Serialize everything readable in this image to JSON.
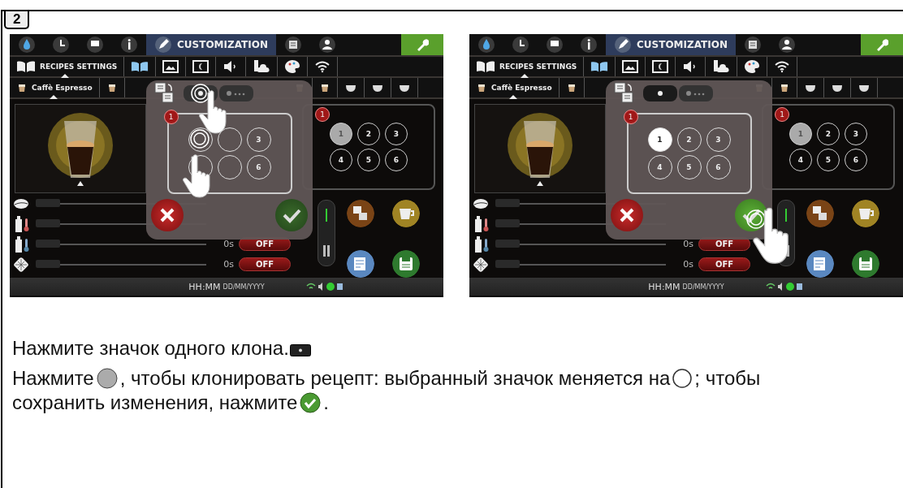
{
  "step": {
    "label": "2"
  },
  "screens": [
    {
      "top_tabs": [
        {
          "selected": false
        },
        {
          "selected": false
        },
        {
          "selected": false
        },
        {
          "selected": false
        },
        {
          "label": "CUSTOMIZATION",
          "selected": true
        },
        {
          "selected": false
        },
        {
          "selected": false
        }
      ],
      "settings_tabs": [
        {
          "label": "RECIPES SETTINGS",
          "selected": true
        },
        {
          "selected": false
        },
        {
          "selected": false
        },
        {
          "selected": false
        },
        {
          "selected": false
        },
        {
          "selected": false
        },
        {
          "selected": false
        },
        {
          "selected": false
        }
      ],
      "recipe_tabs": [
        {
          "label": "Caffè Espresso",
          "selected": true
        },
        {
          "selected": false
        },
        {
          "selected": false
        },
        {
          "selected": false
        },
        {
          "selected": false
        },
        {
          "selected": false
        },
        {
          "selected": false
        }
      ],
      "sliders": [
        {
          "level": 0
        },
        {
          "level": 0
        },
        {
          "level": 0,
          "time": "0s",
          "switch": "OFF",
          "on": false
        },
        {
          "level": 0,
          "time": "0s",
          "switch": "OFF",
          "on": false
        }
      ],
      "preview_panel": {
        "badge": "1",
        "circles": [
          {
            "label": "1",
            "selected": true
          },
          {
            "label": "2",
            "selected": false
          },
          {
            "label": "3",
            "selected": false
          },
          {
            "label": "4",
            "selected": false
          },
          {
            "label": "5",
            "selected": false
          },
          {
            "label": "6",
            "selected": false
          }
        ]
      },
      "popup": {
        "modes": [
          {
            "selected": false,
            "touched": true
          },
          {
            "selected": false,
            "touched": false
          }
        ],
        "badge": "1",
        "circles": [
          {
            "selected": false,
            "touched": true
          },
          {
            "selected": false,
            "touched": false
          },
          {
            "label": "3",
            "selected": false,
            "touched": false
          },
          {
            "selected": false,
            "touched": false
          },
          {
            "selected": false,
            "touched": false
          },
          {
            "label": "6",
            "selected": false,
            "touched": false
          }
        ],
        "cancel": {
          "touched": false
        },
        "confirm": {
          "touched": false
        }
      },
      "status": {
        "time": "HH:MM",
        "date": "DD/MM/YYYY"
      }
    },
    {
      "top_tabs": [
        {
          "selected": false
        },
        {
          "selected": false
        },
        {
          "selected": false
        },
        {
          "selected": false
        },
        {
          "label": "CUSTOMIZATION",
          "selected": true
        },
        {
          "selected": false
        },
        {
          "selected": false
        }
      ],
      "settings_tabs": [
        {
          "label": "RECIPES SETTINGS",
          "selected": true
        },
        {
          "selected": false
        },
        {
          "selected": false
        },
        {
          "selected": false
        },
        {
          "selected": false
        },
        {
          "selected": false
        },
        {
          "selected": false
        },
        {
          "selected": false
        }
      ],
      "recipe_tabs": [
        {
          "label": "Caffè Espresso",
          "selected": true
        },
        {
          "selected": false
        },
        {
          "selected": false
        },
        {
          "selected": false
        },
        {
          "selected": false
        },
        {
          "selected": false
        },
        {
          "selected": false
        }
      ],
      "sliders": [
        {
          "level": 0
        },
        {
          "level": 0
        },
        {
          "level": 0,
          "time": "0s",
          "switch": "OFF",
          "on": false
        },
        {
          "level": 0,
          "time": "0s",
          "switch": "OFF",
          "on": false
        }
      ],
      "preview_panel": {
        "badge": "1",
        "circles": [
          {
            "label": "1",
            "selected": true
          },
          {
            "label": "2",
            "selected": false
          },
          {
            "label": "3",
            "selected": false
          },
          {
            "label": "4",
            "selected": false
          },
          {
            "label": "5",
            "selected": false
          },
          {
            "label": "6",
            "selected": false
          }
        ]
      },
      "popup": {
        "modes": [
          {
            "selected": true,
            "touched": false
          },
          {
            "selected": false,
            "touched": false
          }
        ],
        "badge": "1",
        "circles": [
          {
            "label": "1",
            "selected": true,
            "touched": false
          },
          {
            "label": "2",
            "selected": false,
            "touched": false
          },
          {
            "label": "3",
            "selected": false,
            "touched": false
          },
          {
            "label": "4",
            "selected": false,
            "touched": false
          },
          {
            "label": "5",
            "selected": false,
            "touched": false
          },
          {
            "label": "6",
            "selected": false,
            "touched": false
          }
        ],
        "cancel": {
          "touched": false
        },
        "confirm": {
          "touched": true
        }
      },
      "status": {
        "time": "HH:MM",
        "date": "DD/MM/YYYY"
      }
    }
  ],
  "instructions": [
    [
      {
        "kind": "text",
        "text": "Нажмите значок одного клона."
      },
      {
        "kind": "single-clone"
      }
    ],
    [
      {
        "kind": "text",
        "text": "Нажмите"
      },
      {
        "kind": "grey-circle"
      },
      {
        "kind": "text",
        "text": ", чтобы клонировать рецепт: выбранный значок меняется на"
      },
      {
        "kind": "white-circle"
      },
      {
        "kind": "text",
        "text": "; чтобы"
      },
      {
        "kind": "text",
        "text": "сохранить изменения, нажмите"
      },
      {
        "kind": "check"
      },
      {
        "kind": "text",
        "text": "."
      }
    ]
  ]
}
